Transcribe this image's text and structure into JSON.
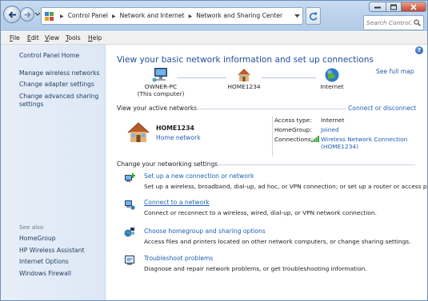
{
  "breadcrumbs": [
    "Control Panel",
    "Network and Internet",
    "Network and Sharing Center"
  ],
  "search": {
    "placeholder": "Search Control..."
  },
  "menu": [
    "File",
    "Edit",
    "View",
    "Tools",
    "Help"
  ],
  "left_pane": {
    "home": "Control Panel Home",
    "links": [
      "Manage wireless networks",
      "Change adapter settings",
      "Change advanced sharing settings"
    ],
    "see_also_label": "See also",
    "see_also": [
      "HomeGroup",
      "HP Wireless Assistant",
      "Internet Options",
      "Windows Firewall"
    ]
  },
  "main": {
    "title": "View your basic network information and set up connections",
    "see_full_map": "See full map",
    "map": {
      "pc_name": "OWNER-PC",
      "pc_sub": "(This computer)",
      "network": "HOME1234",
      "internet": "Internet"
    },
    "active_networks_label": "View your active networks",
    "connect_or_disconnect": "Connect or disconnect",
    "network_name": "HOME1234",
    "network_type": "Home network",
    "access_type_label": "Access type:",
    "access_type_value": "Internet",
    "homegroup_label": "HomeGroup:",
    "homegroup_value": "Joined",
    "connections_label": "Connections:",
    "connection_line1": "Wireless Network Connection",
    "connection_line2": "(HOME1234)",
    "change_settings_label": "Change your networking settings",
    "tasks": [
      {
        "title": "Set up a new connection or network",
        "desc": "Set up a wireless, broadband, dial-up, ad hoc, or VPN connection; or set up a router or access point."
      },
      {
        "title": "Connect to a network",
        "desc": "Connect or reconnect to a wireless, wired, dial-up, or VPN network connection."
      },
      {
        "title": "Choose homegroup and sharing options",
        "desc": "Access files and printers located on other network computers, or change sharing settings."
      },
      {
        "title": "Troubleshoot problems",
        "desc": "Diagnose and repair network problems, or get troubleshooting information."
      }
    ]
  },
  "icons": {
    "back": "back-arrow-icon",
    "forward": "forward-arrow-icon",
    "refresh": "refresh-icon",
    "search": "search-icon",
    "help": "help-icon",
    "computer": "computer-icon",
    "house": "house-icon",
    "globe": "globe-icon",
    "signal": "wireless-signal-icon"
  },
  "colors": {
    "link": "#1f5fb4",
    "title": "#1f4e9b",
    "pane": "#e3ecf7"
  }
}
